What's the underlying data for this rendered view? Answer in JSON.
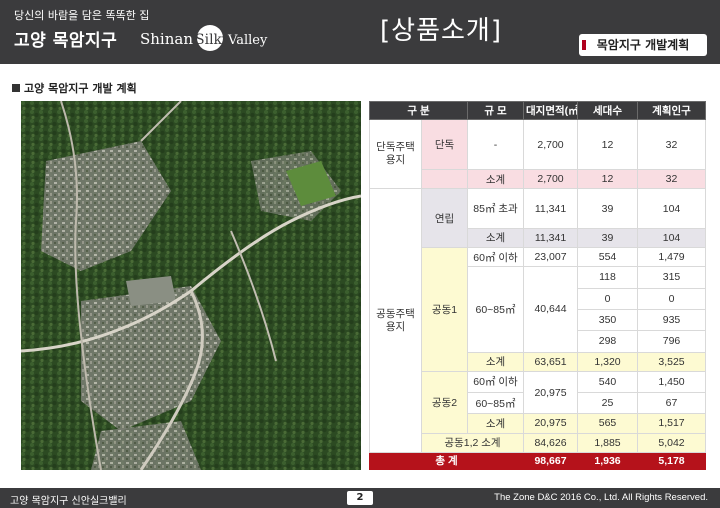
{
  "header": {
    "tagline": "당신의 바람을 담은 똑똑한 집",
    "brand": "고양 목암지구",
    "logo_text_a": "Shinan",
    "logo_text_b": "Silky",
    "logo_text_c": "Valley",
    "page_heading": "[상품소개]",
    "section_badge": "목암지구 개발계획",
    "accent_color": "#b0001e",
    "bar_color": "#3b3b3d"
  },
  "section_title": "고양 목암지구 개발 계획",
  "table": {
    "headers": {
      "category": "구 분",
      "scale": "규 모",
      "area": "대지면적(㎡)",
      "households": "세대수",
      "population": "계획인구"
    },
    "detached": {
      "group": "단독주택 용지",
      "type": "단독",
      "row": {
        "scale": "-",
        "area": "2,700",
        "households": "12",
        "population": "32"
      },
      "subtotal": {
        "label": "소계",
        "area": "2,700",
        "households": "12",
        "population": "32"
      }
    },
    "multi": {
      "group": "공동주택 용지",
      "townhouse": {
        "type": "연립",
        "row": {
          "scale": "85㎡ 초과",
          "area": "11,341",
          "households": "39",
          "population": "104"
        },
        "subtotal": {
          "label": "소계",
          "area": "11,341",
          "households": "39",
          "population": "104"
        }
      },
      "apt1": {
        "type": "공동1",
        "row1": {
          "scale": "60㎡ 이하",
          "area": "23,007",
          "households": "554",
          "population": "1,479"
        },
        "mid_scale": "60~85㎡",
        "mid_area": "40,644",
        "mid_rows": [
          {
            "households": "118",
            "population": "315"
          },
          {
            "households": "0",
            "population": "0"
          },
          {
            "households": "350",
            "population": "935"
          },
          {
            "households": "298",
            "population": "796"
          }
        ],
        "subtotal": {
          "label": "소계",
          "area": "63,651",
          "households": "1,320",
          "population": "3,525"
        }
      },
      "apt2": {
        "type": "공동2",
        "row1": {
          "scale": "60㎡ 이하",
          "households": "540",
          "population": "1,450"
        },
        "row2": {
          "scale": "60~85㎡",
          "households": "25",
          "population": "67"
        },
        "area": "20,975",
        "subtotal": {
          "label": "소계",
          "area": "20,975",
          "households": "565",
          "population": "1,517"
        }
      },
      "combined": {
        "label": "공동1,2 소계",
        "area": "84,626",
        "households": "1,885",
        "population": "5,042"
      }
    },
    "total": {
      "label": "총 계",
      "area": "98,667",
      "households": "1,936",
      "population": "5,178"
    }
  },
  "footer": {
    "left": "고양 목암지구 신안실크밸리",
    "page": "2",
    "right": "The Zone D&C 2016 Co., Ltd. All Rights Reserved."
  }
}
